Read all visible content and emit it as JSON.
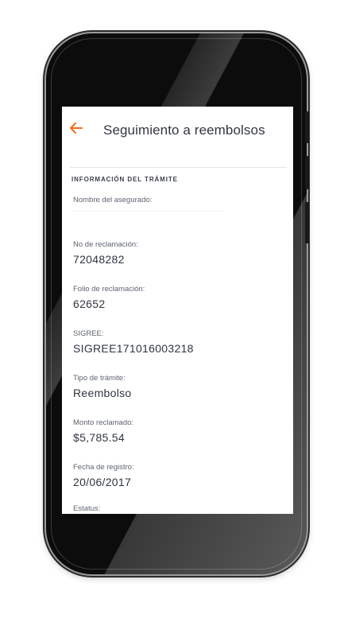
{
  "appbar": {
    "title": "Seguimiento a reembolsos",
    "back_icon": "arrow-left-icon",
    "accent_color": "#f26b21"
  },
  "section": {
    "title": "INFORMACIÓN DEL TRÁMITE"
  },
  "fields": {
    "asegurado": {
      "label": "Nombre del asegurado:",
      "value": ""
    },
    "reclamacion": {
      "label": "No de reclamación:",
      "value": "72048282"
    },
    "folio": {
      "label": "Folio de reclamación:",
      "value": "62652"
    },
    "sigree": {
      "label": "SIGREE:",
      "value": "SIGREE171016003218"
    },
    "tipo": {
      "label": "Tipo de trámite:",
      "value": "Reembolso"
    },
    "monto": {
      "label": "Monto reclamado:",
      "value": "$5,785.54"
    },
    "fecha": {
      "label": "Fecha de registro:",
      "value": "20/06/2017"
    },
    "estatus": {
      "label": "Estatus:",
      "value": ""
    }
  }
}
